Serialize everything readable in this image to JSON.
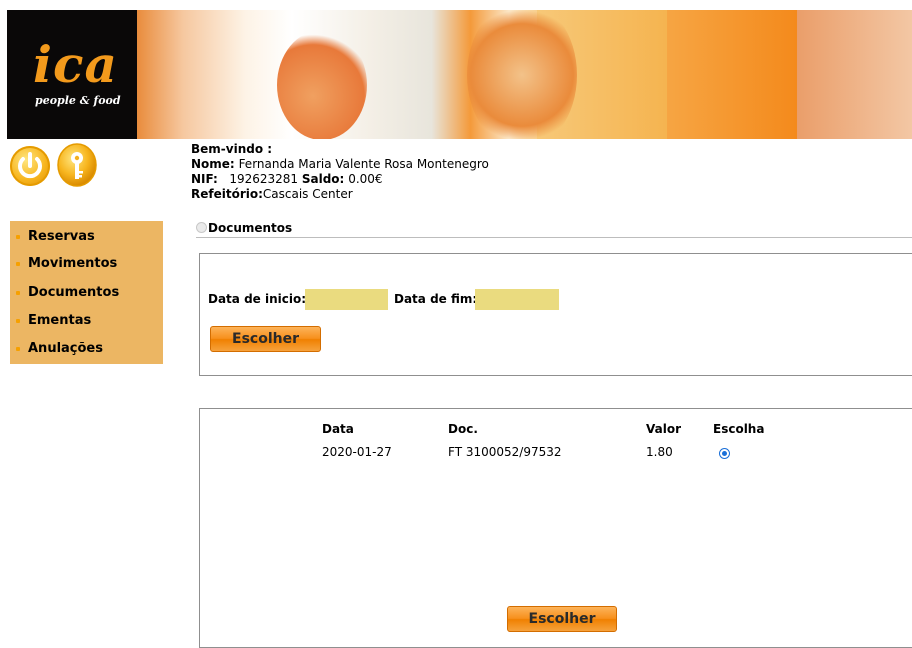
{
  "brand": {
    "logo_text": "ica",
    "tagline": "people & food"
  },
  "welcome": {
    "greeting": "Bem-vindo :",
    "name_label": "Nome:",
    "name_value": "Fernanda Maria Valente Rosa Montenegro",
    "nif_label": "NIF:",
    "nif_value": "192623281",
    "saldo_label": "Saldo:",
    "saldo_value": "0.00€",
    "refeitorio_label": "Refeitório:",
    "refeitorio_value": "Cascais Center"
  },
  "sidebar": {
    "items": [
      {
        "label": "Reservas"
      },
      {
        "label": "Movimentos"
      },
      {
        "label": "Documentos"
      },
      {
        "label": "Ementas"
      },
      {
        "label": "Anulações"
      }
    ]
  },
  "section": {
    "title": "Documentos"
  },
  "filter": {
    "start_label": "Data de inicio:",
    "start_value": "",
    "end_label": "Data de fim:",
    "end_value": "",
    "submit_label": "Escolher"
  },
  "results": {
    "headers": [
      "Data",
      "Doc.",
      "Valor",
      "Escolha"
    ],
    "rows": [
      {
        "data": "2020-01-27",
        "doc": "FT 3100052/97532",
        "valor": "1.80",
        "selected": true
      }
    ],
    "submit_label": "Escolher"
  },
  "colors": {
    "accent": "#f7901c",
    "sidebar_bg": "#ecb663",
    "input_bg": "#eadb7f",
    "radio": "#1a6fd8"
  },
  "icons": {
    "logout": "power-icon",
    "password": "key-icon"
  }
}
